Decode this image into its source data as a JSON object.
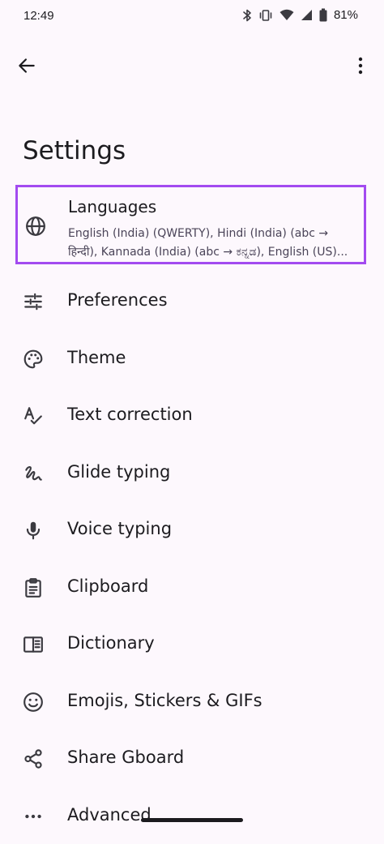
{
  "status_bar": {
    "time": "12:49",
    "battery_percent": "81%",
    "icons": [
      "bluetooth-icon",
      "vibrate-icon",
      "wifi-icon",
      "signal-icon",
      "battery-icon"
    ]
  },
  "app_bar": {
    "back_icon": "arrow-back-icon",
    "more_icon": "more-vert-icon"
  },
  "page_title": "Settings",
  "languages": {
    "title": "Languages",
    "summary_line1": "English (India) (QWERTY), Hindi (India) (abc →",
    "summary_line2": "हिन्दी), Kannada (India) (abc → ಕನ್ನಡ), English (US)...",
    "highlight_color": "#a34bf0"
  },
  "items": [
    {
      "label": "Preferences",
      "icon": "tune-icon"
    },
    {
      "label": "Theme",
      "icon": "palette-icon"
    },
    {
      "label": "Text correction",
      "icon": "spellcheck-icon"
    },
    {
      "label": "Glide typing",
      "icon": "gesture-icon"
    },
    {
      "label": "Voice typing",
      "icon": "mic-icon"
    },
    {
      "label": "Clipboard",
      "icon": "clipboard-icon"
    },
    {
      "label": "Dictionary",
      "icon": "book-icon"
    },
    {
      "label": "Emojis, Stickers & GIFs",
      "icon": "emoji-icon"
    },
    {
      "label": "Share Gboard",
      "icon": "share-icon"
    },
    {
      "label": "Advanced",
      "icon": "more-horiz-icon"
    }
  ]
}
